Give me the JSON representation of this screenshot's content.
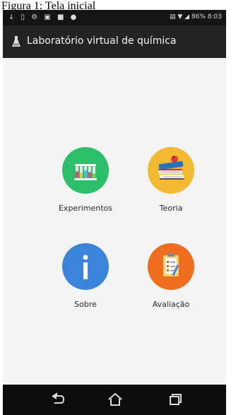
{
  "caption": "Figura 1: Tela inicial",
  "statusbar": {
    "left_icons": "↓ ▯ ⚙ ▣ ■ ●",
    "right_text": "▤ ▼ ◢ 86% 8:03"
  },
  "actionbar": {
    "title": "Laboratório virtual de química",
    "icon": "flask-icon"
  },
  "menu": {
    "experimentos": {
      "label": "Experimentos",
      "icon": "test-tubes-icon",
      "color": "#2bbf6a"
    },
    "teoria": {
      "label": "Teoria",
      "icon": "books-icon",
      "color": "#f2b931"
    },
    "sobre": {
      "label": "Sobre",
      "icon": "info-icon",
      "color": "#3a84d9"
    },
    "avaliacao": {
      "label": "Avaliação",
      "icon": "checklist-icon",
      "color": "#ef6d1f"
    }
  },
  "navbar": {
    "back_icon": "back-icon",
    "home_icon": "home-icon",
    "recents_icon": "recents-icon"
  }
}
